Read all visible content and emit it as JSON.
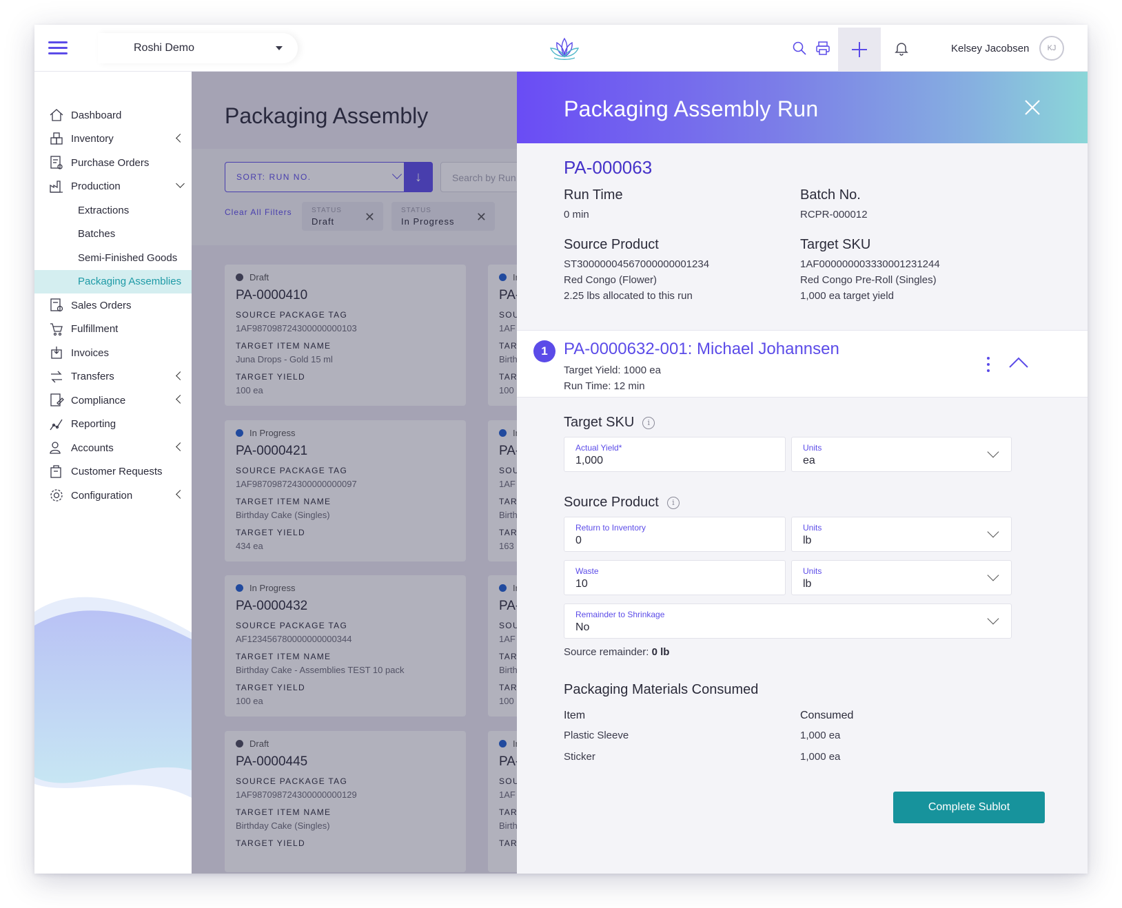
{
  "header": {
    "workspace": "Roshi Demo",
    "user_name": "Kelsey Jacobsen",
    "user_initials": "KJ"
  },
  "sidebar": {
    "items": [
      {
        "label": "Dashboard",
        "icon": "home-icon"
      },
      {
        "label": "Inventory",
        "icon": "boxes-icon",
        "chevron": "left"
      },
      {
        "label": "Purchase Orders",
        "icon": "purchase-order-icon"
      },
      {
        "label": "Production",
        "icon": "factory-icon",
        "chevron": "down"
      },
      {
        "label": "Sales Orders",
        "icon": "sales-order-icon"
      },
      {
        "label": "Fulfillment",
        "icon": "cart-icon"
      },
      {
        "label": "Invoices",
        "icon": "invoice-icon"
      },
      {
        "label": "Transfers",
        "icon": "transfer-icon",
        "chevron": "left"
      },
      {
        "label": "Compliance",
        "icon": "compliance-icon",
        "chevron": "left"
      },
      {
        "label": "Reporting",
        "icon": "reporting-icon"
      },
      {
        "label": "Accounts",
        "icon": "accounts-icon",
        "chevron": "left"
      },
      {
        "label": "Customer Requests",
        "icon": "customer-request-icon"
      },
      {
        "label": "Configuration",
        "icon": "gear-icon",
        "chevron": "left"
      }
    ],
    "production_sub": [
      "Extractions",
      "Batches",
      "Semi-Finished Goods",
      "Packaging Assemblies"
    ],
    "active_sub": "Packaging Assemblies"
  },
  "list_page": {
    "title": "Packaging Assembly",
    "sort_label": "SORT: RUN NO.",
    "search_placeholder": "Search by Run",
    "clear_filters": "Clear All Filters",
    "chips": [
      {
        "key": "STATUS",
        "value": "Draft"
      },
      {
        "key": "STATUS",
        "value": "In Progress"
      }
    ],
    "field_labels": {
      "source": "SOURCE PACKAGE TAG",
      "target_name": "TARGET ITEM NAME",
      "target_yield": "TARGET YIELD"
    },
    "cards": [
      {
        "status": "Draft",
        "status_color": "#4a4a5a",
        "id": "PA-0000410",
        "source_tag": "1AF987098724300000000103",
        "target_name": "Juna Drops - Gold 15 ml",
        "target_yield": "100 ea"
      },
      {
        "status": "In Progress",
        "status_color": "#1e5fd0",
        "id": "PA-0000421",
        "source_tag": "1AF987098724300000000097",
        "target_name": "Birthday Cake (Singles)",
        "target_yield": "434 ea"
      },
      {
        "status": "In Progress",
        "status_color": "#1e5fd0",
        "id": "PA-0000432",
        "source_tag": "AF123456780000000000344",
        "target_name": "Birthday Cake - Assemblies TEST 10 pack",
        "target_yield": "100 ea"
      },
      {
        "status": "Draft",
        "status_color": "#4a4a5a",
        "id": "PA-0000445",
        "source_tag": "1AF987098724300000000129",
        "target_name": "Birthday Cake (Singles)",
        "target_yield": ""
      }
    ],
    "cards_col2": [
      {
        "status": "In",
        "id": "PA-",
        "src": "SOU",
        "tag": "1AF",
        "tgt": "TAR",
        "tname": "Birth",
        "ty": "TAR",
        "tyv": "100"
      },
      {
        "status": "In",
        "id": "PA-",
        "src": "SOU",
        "tag": "1AF",
        "tgt": "TAR",
        "tname": "Birth",
        "ty": "TAR",
        "tyv": "163"
      },
      {
        "status": "In",
        "id": "PA-",
        "src": "SOU",
        "tag": "1AF",
        "tgt": "TAR",
        "tname": "Birth",
        "ty": "TAR",
        "tyv": "100"
      },
      {
        "status": "In",
        "id": "PA-",
        "src": "SOU",
        "tag": "1AF",
        "tgt": "TAR",
        "tname": "Birth",
        "ty": "TAR",
        "tyv": ""
      }
    ]
  },
  "drawer": {
    "title": "Packaging Assembly Run",
    "run_id": "PA-000063",
    "run_time_label": "Run Time",
    "run_time": "0 min",
    "batch_label": "Batch No.",
    "batch": "RCPR-000012",
    "source_label": "Source Product",
    "source_lines": [
      "ST30000004567000000001234",
      "Red Congo (Flower)",
      "2.25 lbs allocated to this run"
    ],
    "target_label": "Target SKU",
    "target_lines": [
      "1AF000000003330001231244",
      "Red Congo Pre-Roll (Singles)",
      "1,000 ea target yield"
    ],
    "sublot": {
      "number": "1",
      "title": "PA-0000632-001: Michael Johannsen",
      "target_yield": "Target Yield: 1000 ea",
      "run_time": "Run Time: 12 min"
    },
    "target_sku_section": "Target SKU",
    "actual_yield_label": "Actual Yield*",
    "actual_yield": "1,000",
    "units_label": "Units",
    "target_units": "ea",
    "source_product_section": "Source Product",
    "return_label": "Return to Inventory",
    "return_value": "0",
    "return_units": "lb",
    "waste_label": "Waste",
    "waste_value": "10",
    "waste_units": "lb",
    "shrinkage_label": "Remainder to Shrinkage",
    "shrinkage_value": "No",
    "remainder_label": "Source remainder:",
    "remainder_value": "0 lb",
    "materials_section": "Packaging Materials Consumed",
    "materials_headers": [
      "Item",
      "Consumed"
    ],
    "materials": [
      {
        "item": "Plastic Sleeve",
        "consumed": "1,000 ea"
      },
      {
        "item": "Sticker",
        "consumed": "1,000 ea"
      }
    ],
    "complete_button": "Complete Sublot"
  },
  "colors": {
    "accent": "#5b4be8",
    "teal": "#17939c",
    "active_bg": "#d4eef0"
  }
}
